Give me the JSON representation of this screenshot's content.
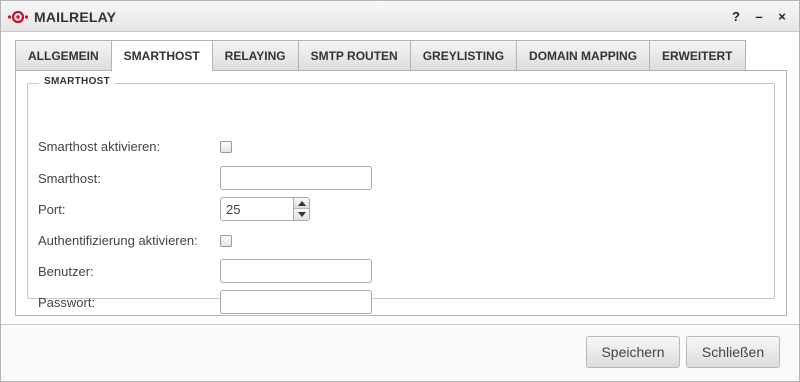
{
  "window": {
    "title": "MAILRELAY",
    "controls": {
      "help": "?",
      "minimize": "–",
      "close": "×"
    },
    "logo_color": "#c8102e"
  },
  "tabs": [
    {
      "label": "ALLGEMEIN",
      "active": false
    },
    {
      "label": "SMARTHOST",
      "active": true
    },
    {
      "label": "RELAYING",
      "active": false
    },
    {
      "label": "SMTP ROUTEN",
      "active": false
    },
    {
      "label": "GREYLISTING",
      "active": false
    },
    {
      "label": "DOMAIN MAPPING",
      "active": false
    },
    {
      "label": "ERWEITERT",
      "active": false
    }
  ],
  "smarthost": {
    "legend": "SMARTHOST",
    "enable_label": "Smarthost aktivieren:",
    "enable_checked": false,
    "host_label": "Smarthost:",
    "host_value": "",
    "port_label": "Port:",
    "port_value": "25",
    "auth_label": "Authentifizierung aktivieren:",
    "auth_checked": false,
    "user_label": "Benutzer:",
    "user_value": "",
    "password_label": "Passwort:",
    "password_value": ""
  },
  "footer": {
    "save_label": "Speichern",
    "close_label": "Schließen"
  }
}
